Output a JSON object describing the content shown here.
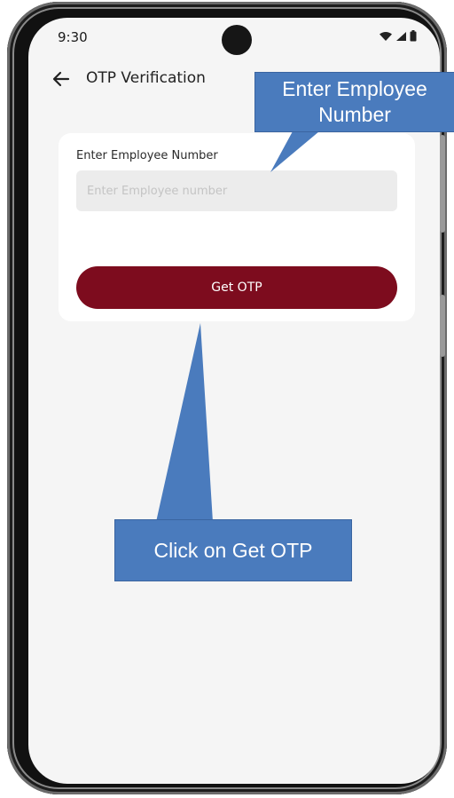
{
  "status_bar": {
    "time": "9:30",
    "icons": [
      "wifi-icon",
      "signal-icon",
      "battery-icon"
    ]
  },
  "app_bar": {
    "back_icon": "arrow-left-icon",
    "title": "OTP Verification"
  },
  "form": {
    "label": "Enter Employee Number",
    "input_placeholder": "Enter Employee number",
    "input_value": "",
    "button_label": "Get OTP"
  },
  "callouts": {
    "top": {
      "line1": "Enter Employee",
      "line2": "Number"
    },
    "bottom": "Click on Get OTP"
  },
  "colors": {
    "primary": "#7d0c1e",
    "callout": "#4a7bbd",
    "screen_bg": "#f5f5f5"
  }
}
